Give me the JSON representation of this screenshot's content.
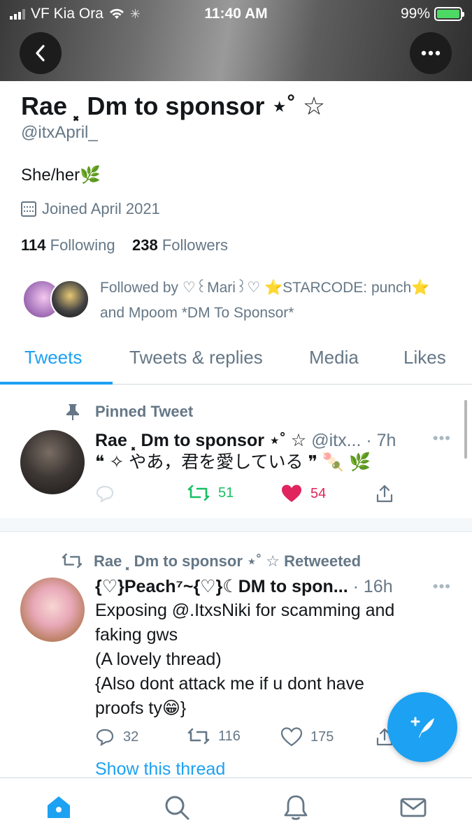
{
  "status_bar": {
    "carrier": "VF Kia Ora",
    "time": "11:40 AM",
    "battery": "99%"
  },
  "profile": {
    "name": "Rae ⸼ Dm to sponsor ⋆˚ ☆",
    "handle": "@itxApril_",
    "bio": "She/her🌿",
    "joined": "Joined April 2021",
    "following_count": "114",
    "following_label": "Following",
    "followers_count": "238",
    "followers_label": "Followers",
    "followed_by": "Followed by ♡꒰Mari꒱♡ ⭐STARCODE: punch⭐ and Mpoom *DM To Sponsor*"
  },
  "tabs": [
    {
      "label": "Tweets",
      "active": true
    },
    {
      "label": "Tweets & replies",
      "active": false
    },
    {
      "label": "Media",
      "active": false
    },
    {
      "label": "Likes",
      "active": false
    }
  ],
  "tweets": [
    {
      "context": "Pinned Tweet",
      "name": "Rae ⸼ Dm to sponsor ⋆˚ ☆",
      "meta": "@itx... · 7h",
      "text": "❝ ✧ やあ，君を愛している ❞ 🍡 🌿",
      "retweets": "51",
      "likes": "54"
    },
    {
      "context": "Rae ⸼ Dm to sponsor ⋆˚ ☆ Retweeted",
      "name": "{♡}Peach⁷~{♡}☾DM to spon...",
      "meta": "· 16h",
      "text": "Exposing @.ItxsNiki for scamming and\nfaking gws\n(A lovely thread)\n{Also dont attack me if u dont have\nproofs ty😁}",
      "replies": "32",
      "retweets": "116",
      "likes": "175",
      "show_thread": "Show this thread"
    }
  ],
  "icons": {
    "back": "chevron-left-icon",
    "more": "more-icon",
    "pin": "pin-icon",
    "calendar": "calendar-icon",
    "home": "home-icon",
    "search": "search-icon",
    "notifications": "bell-icon",
    "messages": "mail-icon",
    "compose": "compose-icon"
  },
  "colors": {
    "accent": "#1da1f2",
    "retweet_green": "#17bf63",
    "like_red": "#e0245e",
    "secondary_text": "#657786"
  }
}
